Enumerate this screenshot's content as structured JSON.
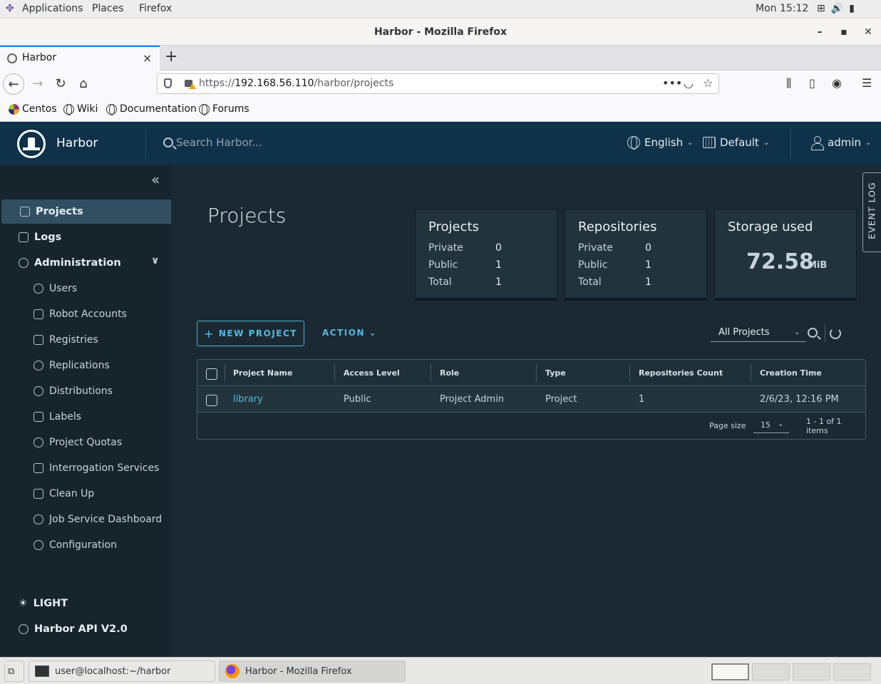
{
  "gnome": {
    "menus": [
      "Applications",
      "Places",
      "Firefox"
    ],
    "clock": "Mon 15:12"
  },
  "window": {
    "title": "Harbor - Mozilla Firefox",
    "minimize": "–",
    "maximize": "▪",
    "close": "✕"
  },
  "browser": {
    "tab_title": "Harbor",
    "tab_close": "×",
    "new_tab": "+",
    "url_prefix": "https://",
    "url_host": "192.168.56.110",
    "url_path": "/harbor/projects",
    "bookmarks": [
      "Centos",
      "Wiki",
      "Documentation",
      "Forums"
    ]
  },
  "harbor": {
    "app_name": "Harbor",
    "search_placeholder": "Search Harbor...",
    "language": "English",
    "schedule": "Default",
    "user": "admin"
  },
  "sidebar": {
    "projects": "Projects",
    "logs": "Logs",
    "administration": "Administration",
    "admin_items": [
      "Users",
      "Robot Accounts",
      "Registries",
      "Replications",
      "Distributions",
      "Labels",
      "Project Quotas",
      "Interrogation Services",
      "Clean Up",
      "Job Service Dashboard",
      "Configuration"
    ],
    "theme": "LIGHT",
    "api": "Harbor API V2.0"
  },
  "main": {
    "title": "Projects",
    "event_log": "EVENT LOG",
    "cards": {
      "projects": {
        "title": "Projects",
        "private_label": "Private",
        "private": "0",
        "public_label": "Public",
        "public": "1",
        "total_label": "Total",
        "total": "1"
      },
      "repositories": {
        "title": "Repositories",
        "private_label": "Private",
        "private": "0",
        "public_label": "Public",
        "public": "1",
        "total_label": "Total",
        "total": "1"
      },
      "storage": {
        "title": "Storage used",
        "value": "72.58",
        "unit": "MiB"
      }
    },
    "new_project": "NEW PROJECT",
    "action": "ACTION",
    "filter": "All Projects",
    "columns": [
      "Project Name",
      "Access Level",
      "Role",
      "Type",
      "Repositories Count",
      "Creation Time"
    ],
    "rows": [
      {
        "name": "library",
        "access": "Public",
        "role": "Project Admin",
        "type": "Project",
        "repo_count": "1",
        "created": "2/6/23, 12:16 PM"
      }
    ],
    "page_size_label": "Page size",
    "page_size": "15",
    "pagination": "1 - 1 of 1 items"
  },
  "taskbar": {
    "terminal": "user@localhost:~/harbor",
    "firefox": "Harbor - Mozilla Firefox"
  }
}
